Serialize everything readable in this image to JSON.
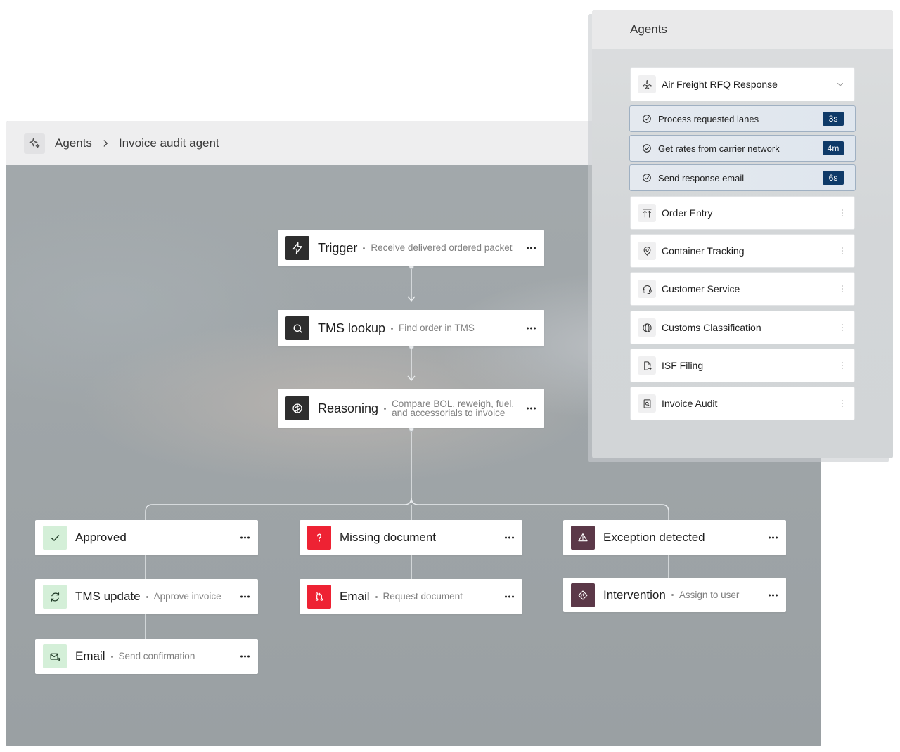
{
  "breadcrumb": {
    "root": "Agents",
    "current": "Invoice audit agent",
    "icon": "sparkle-icon"
  },
  "flow": {
    "trigger": {
      "title": "Trigger",
      "subtitle": "Receive delivered ordered packet",
      "icon": "lightning-icon"
    },
    "tms_lookup": {
      "title": "TMS lookup",
      "subtitle": "Find order in TMS",
      "icon": "search-icon"
    },
    "reasoning": {
      "title": "Reasoning",
      "subtitle_line1": "Compare BOL, reweigh, fuel,",
      "subtitle_line2": "and accessorials to invoice",
      "icon": "brain-icon"
    },
    "approved": {
      "title": "Approved",
      "icon": "check-icon"
    },
    "tms_update": {
      "title": "TMS update",
      "subtitle": "Approve invoice",
      "icon": "refresh-icon"
    },
    "email_confirm": {
      "title": "Email",
      "subtitle": "Send confirmation",
      "icon": "mail-send-icon"
    },
    "missing_document": {
      "title": "Missing document",
      "icon": "question-icon"
    },
    "email_request": {
      "title": "Email",
      "subtitle": "Request document",
      "icon": "merge-icon"
    },
    "exception": {
      "title": "Exception detected",
      "icon": "warning-icon"
    },
    "intervention": {
      "title": "Intervention",
      "subtitle": "Assign to user",
      "icon": "diamond-arrow-icon"
    }
  },
  "agents_panel": {
    "title": "Agents",
    "selected": {
      "label": "Air Freight RFQ Response",
      "icon": "airplane-icon"
    },
    "steps": [
      {
        "label": "Process requested lanes",
        "duration": "3s"
      },
      {
        "label": "Get rates from carrier network",
        "duration": "4m"
      },
      {
        "label": "Send response email",
        "duration": "6s"
      }
    ],
    "agents": [
      {
        "label": "Order Entry",
        "icon": "upload-arrows-icon"
      },
      {
        "label": "Container Tracking",
        "icon": "location-pin-icon"
      },
      {
        "label": "Customer Service",
        "icon": "headset-icon"
      },
      {
        "label": "Customs Classification",
        "icon": "globe-icon"
      },
      {
        "label": "ISF Filing",
        "icon": "file-arrow-icon"
      },
      {
        "label": "Invoice Audit",
        "icon": "invoice-search-icon"
      }
    ]
  },
  "colors": {
    "badge": "#0f3a68",
    "success": "#d4efd8",
    "error": "#ee2233",
    "exception": "#5b3848",
    "dark_icon": "#2e2e2e"
  }
}
